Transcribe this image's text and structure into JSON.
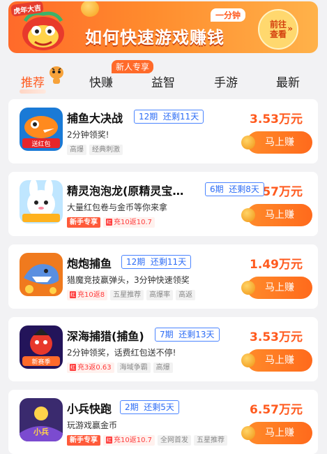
{
  "banner": {
    "title": "如何快速游戏赚钱",
    "badge": "一分钟",
    "goto_label": "前往查看",
    "mascot_tag": "虎年大吉"
  },
  "tabs": [
    {
      "label": "推荐",
      "active": true
    },
    {
      "label": "快赚"
    },
    {
      "label": "益智"
    },
    {
      "label": "手游"
    },
    {
      "label": "最新"
    }
  ],
  "tab_badge": "新人专享",
  "button_label": "马上赚",
  "games": [
    {
      "name": "捕鱼大决战",
      "period": "12期",
      "remain": "还剩11天",
      "desc": "2分钟领奖!",
      "tags": [
        {
          "text": "高爆"
        },
        {
          "text": "经典刺激"
        }
      ],
      "amount": "3.53万元",
      "icon": "fish-game-icon"
    },
    {
      "name": "精灵泡泡龙(原精灵宝…",
      "period": "6期",
      "remain": "还剩8天",
      "desc": "大量红包卷与金币等你来拿",
      "tags": [
        {
          "text": "新手专享",
          "kind": "new"
        },
        {
          "text": "充10返10.7",
          "kind": "red"
        }
      ],
      "amount": "6.57万元",
      "icon": "bunny-bubble-icon"
    },
    {
      "name": "炮炮捕鱼",
      "period": "12期",
      "remain": "还剩11天",
      "desc": "猎魔竞技赢弹头，3分钟快速领奖",
      "tags": [
        {
          "text": "充10返8",
          "kind": "red"
        },
        {
          "text": "五星推荐"
        },
        {
          "text": "高爆率"
        },
        {
          "text": "高返"
        }
      ],
      "amount": "1.49万元",
      "icon": "shark-cannon-icon"
    },
    {
      "name": "深海捕猎(捕鱼)",
      "period": "7期",
      "remain": "还剩13天",
      "desc": "2分钟领奖，话费红包送不停!",
      "tags": [
        {
          "text": "充3返0.63",
          "kind": "red"
        },
        {
          "text": "海域争霸"
        },
        {
          "text": "高爆"
        }
      ],
      "amount": "3.53万元",
      "icon": "deep-sea-icon"
    },
    {
      "name": "小兵快跑",
      "period": "2期",
      "remain": "还剩5天",
      "desc": "玩游戏赢金币",
      "tags": [
        {
          "text": "新手专享",
          "kind": "new"
        },
        {
          "text": "充10返10.7",
          "kind": "red"
        },
        {
          "text": "全网首发"
        },
        {
          "text": "五星推荐"
        }
      ],
      "amount": "6.57万元",
      "icon": "soldier-run-icon"
    }
  ]
}
